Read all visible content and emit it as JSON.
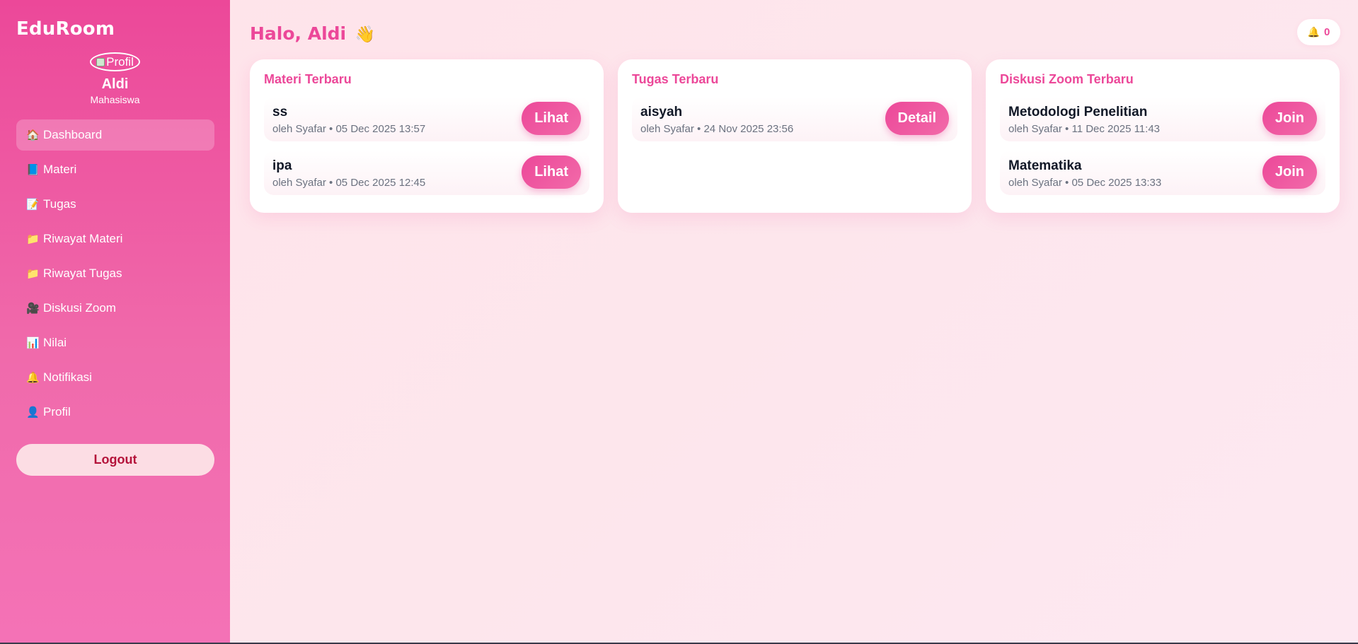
{
  "sidebar": {
    "brand": "EduRoom",
    "avatar_alt": "Profil",
    "user_name": "Aldi",
    "user_role": "Mahasiswa",
    "items": [
      {
        "icon": "🏠",
        "label": "Dashboard",
        "active": true
      },
      {
        "icon": "📘",
        "label": "Materi"
      },
      {
        "icon": "📝",
        "label": "Tugas"
      },
      {
        "icon": "📁",
        "label": "Riwayat Materi"
      },
      {
        "icon": "📁",
        "label": "Riwayat Tugas"
      },
      {
        "icon": "🎥",
        "label": "Diskusi Zoom"
      },
      {
        "icon": "📊",
        "label": "Nilai"
      },
      {
        "icon": "🔔",
        "label": "Notifikasi"
      },
      {
        "icon": "👤",
        "label": "Profil"
      }
    ],
    "logout_label": "Logout"
  },
  "header": {
    "greeting": "Halo, Aldi",
    "wave_icon": "👋",
    "notif_icon": "🔔",
    "notif_count": "0"
  },
  "cards": [
    {
      "title": "Materi Terbaru",
      "items": [
        {
          "title": "ss",
          "meta": "oleh Syafar • 05 Dec 2025 13:57",
          "button": "Lihat"
        },
        {
          "title": "ipa",
          "meta": "oleh Syafar • 05 Dec 2025 12:45",
          "button": "Lihat"
        }
      ]
    },
    {
      "title": "Tugas Terbaru",
      "items": [
        {
          "title": "aisyah",
          "meta": "oleh Syafar • 24 Nov 2025 23:56",
          "button": "Detail"
        }
      ]
    },
    {
      "title": "Diskusi Zoom Terbaru",
      "items": [
        {
          "title": "Metodologi Penelitian",
          "meta": "oleh Syafar • 11 Dec 2025 11:43",
          "button": "Join"
        },
        {
          "title": "Matematika",
          "meta": "oleh Syafar • 05 Dec 2025 13:33",
          "button": "Join"
        }
      ]
    }
  ],
  "colors": {
    "accent": "#ec4899",
    "logout_text": "#b4123a"
  }
}
